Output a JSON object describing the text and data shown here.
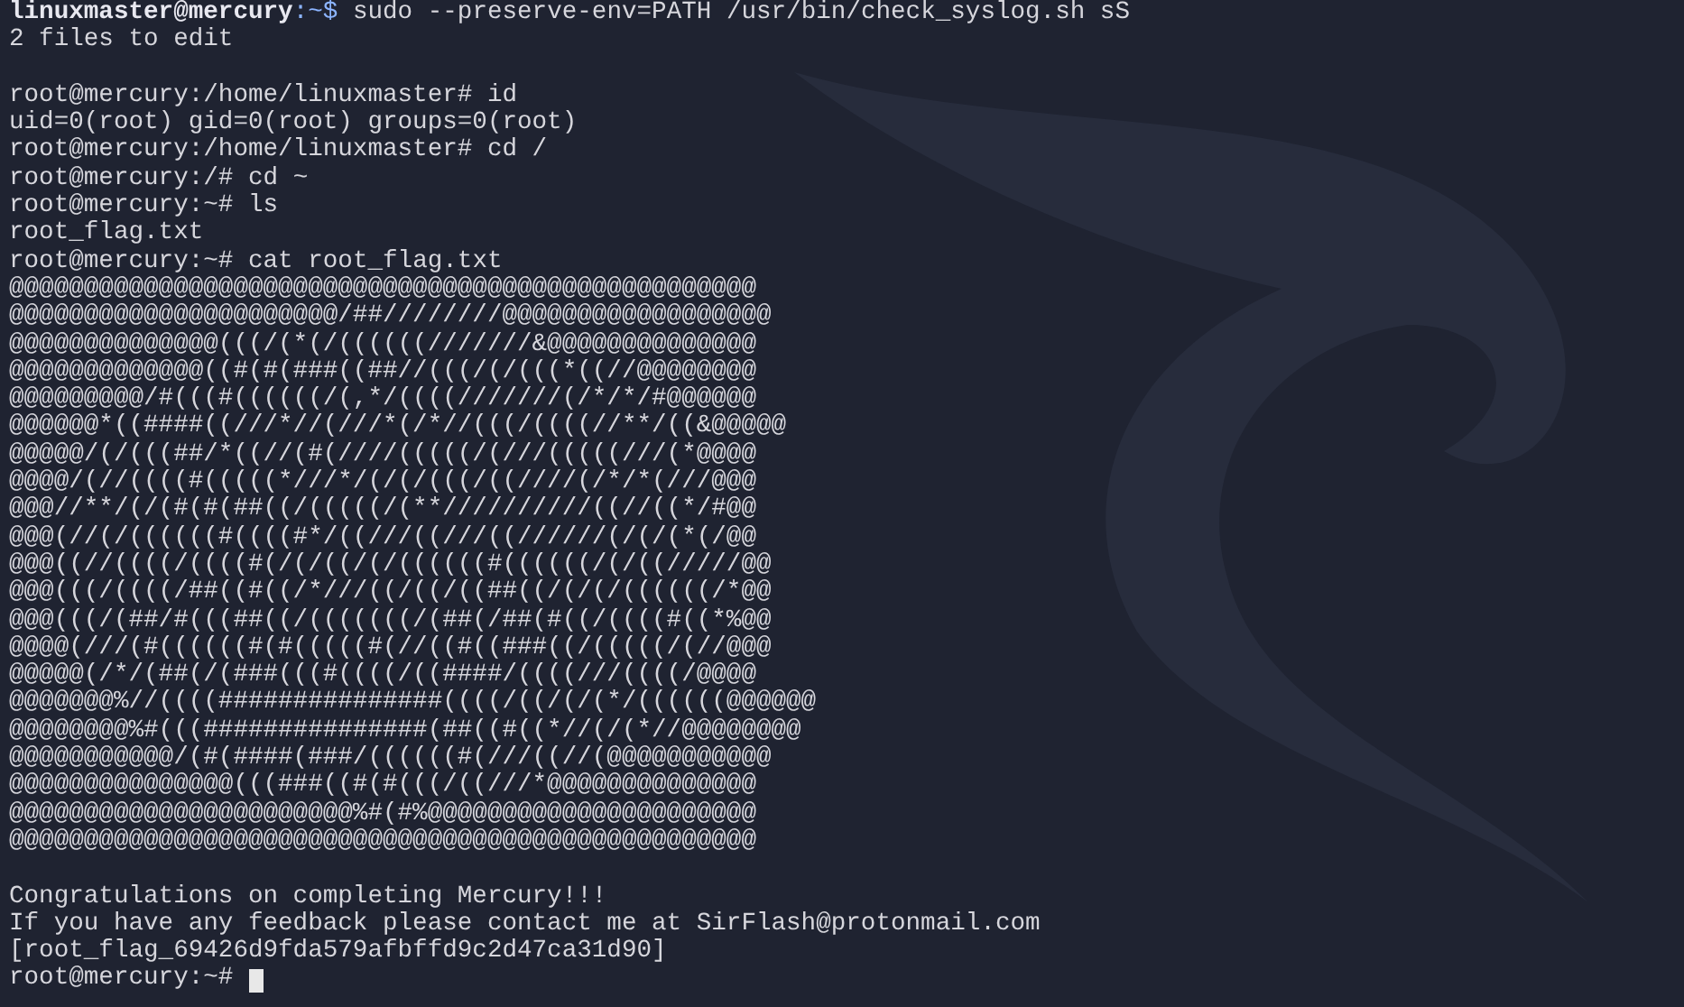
{
  "lines": [
    {
      "kind": "user_prompt",
      "user": "linuxmaster@mercury",
      "path": ":~$",
      "command": "sudo --preserve-env=PATH /usr/bin/check_syslog.sh sS"
    },
    {
      "kind": "output",
      "text": "2 files to edit"
    },
    {
      "kind": "blank"
    },
    {
      "kind": "root_prompt",
      "prompt": "root@mercury:/home/linuxmaster#",
      "command": "id"
    },
    {
      "kind": "output",
      "text": "uid=0(root) gid=0(root) groups=0(root)"
    },
    {
      "kind": "root_prompt",
      "prompt": "root@mercury:/home/linuxmaster#",
      "command": "cd /"
    },
    {
      "kind": "root_prompt",
      "prompt": "root@mercury:/#",
      "command": "cd ~"
    },
    {
      "kind": "root_prompt",
      "prompt": "root@mercury:~#",
      "command": "ls"
    },
    {
      "kind": "output",
      "text": "root_flag.txt"
    },
    {
      "kind": "root_prompt",
      "prompt": "root@mercury:~#",
      "command": "cat root_flag.txt"
    },
    {
      "kind": "art",
      "text": "@@@@@@@@@@@@@@@@@@@@@@@@@@@@@@@@@@@@@@@@@@@@@@@@@@"
    },
    {
      "kind": "art",
      "text": "@@@@@@@@@@@@@@@@@@@@@@/##////////@@@@@@@@@@@@@@@@@@"
    },
    {
      "kind": "art",
      "text": "@@@@@@@@@@@@@@(((/(*(/((((((///////&@@@@@@@@@@@@@@"
    },
    {
      "kind": "art",
      "text": "@@@@@@@@@@@@@((#(#(###((##//(((/(/(((*((//@@@@@@@@"
    },
    {
      "kind": "art",
      "text": "@@@@@@@@@/#(((#((((((/(,*/((((///////(/*/*/#@@@@@@"
    },
    {
      "kind": "art",
      "text": "@@@@@@*((####((///*//(///*(/*//(((/((((//**/((&@@@@@"
    },
    {
      "kind": "art",
      "text": "@@@@@/(/(((##/*((//(#(////(((((/(///(((((///(*@@@@"
    },
    {
      "kind": "art",
      "text": "@@@@/(//((((#(((((*///*/(/(/(((/((////(/*/*(///@@@"
    },
    {
      "kind": "art",
      "text": "@@@//**/(/(#(#(##((/(((((/(**//////////((//((*/#@@"
    },
    {
      "kind": "art",
      "text": "@@@(//(/((((((#((((#*/((///((///((//////(/(/(*(/@@"
    },
    {
      "kind": "art",
      "text": "@@@((//((((/((((#(/(/((/(/((((((#((((((/(/((/////@@"
    },
    {
      "kind": "art",
      "text": "@@@(((/((((/##((#((/*///((/((/((##((/(/(/((((((/*@@"
    },
    {
      "kind": "art",
      "text": "@@@(((/(##/#(((##((/(((((((/(##(/##(#((/((((#((*%@@"
    },
    {
      "kind": "art",
      "text": "@@@@(///(#((((((#(#(((((#(//((#((###((/(((((/(//@@@"
    },
    {
      "kind": "art",
      "text": "@@@@@(/*/(##(/(###(((#((((/((####/((((///((((/@@@@"
    },
    {
      "kind": "art",
      "text": "@@@@@@@%//((((###############((((/((/(/(*/((((((@@@@@@"
    },
    {
      "kind": "art",
      "text": "@@@@@@@@%#(((###############(##((#((*//(/(*//@@@@@@@@"
    },
    {
      "kind": "art",
      "text": "@@@@@@@@@@@/(#(####(###/((((((#(///((//(@@@@@@@@@@@"
    },
    {
      "kind": "art",
      "text": "@@@@@@@@@@@@@@@(((###((#(#(((/((///*@@@@@@@@@@@@@@"
    },
    {
      "kind": "art",
      "text": "@@@@@@@@@@@@@@@@@@@@@@@%#(#%@@@@@@@@@@@@@@@@@@@@@@"
    },
    {
      "kind": "art",
      "text": "@@@@@@@@@@@@@@@@@@@@@@@@@@@@@@@@@@@@@@@@@@@@@@@@@@"
    },
    {
      "kind": "blank"
    },
    {
      "kind": "output",
      "text": "Congratulations on completing Mercury!!!"
    },
    {
      "kind": "output",
      "text": "If you have any feedback please contact me at SirFlash@protonmail.com"
    },
    {
      "kind": "output",
      "text": "[root_flag_69426d9fda579afbffd9c2d47ca31d90]"
    },
    {
      "kind": "root_prompt",
      "prompt": "root@mercury:~#",
      "cursor": true
    }
  ]
}
